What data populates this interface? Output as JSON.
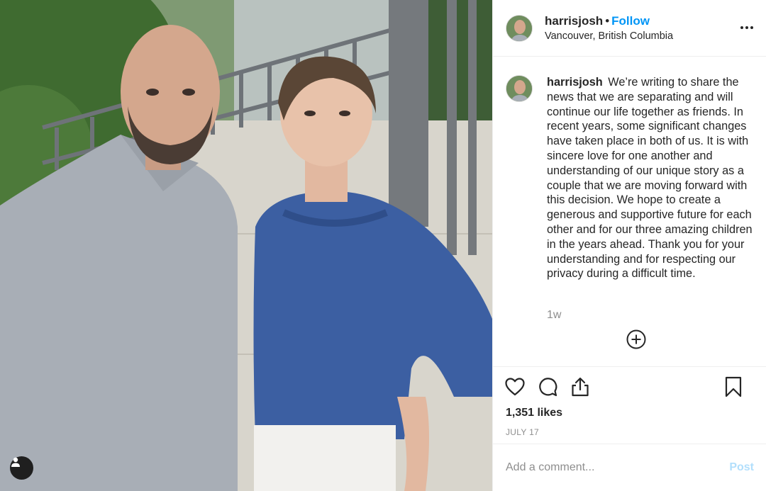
{
  "post": {
    "username": "harrisjosh",
    "separator": "•",
    "follow_label": "Follow",
    "location": "Vancouver, British Columbia",
    "caption": "We’re writing to share the news that we are separating and will continue our life together as friends. In recent years, some significant changes have taken place in both of us. It is with sincere love for one another and understanding of our unique story as a couple that we are moving forward with this decision. We hope to create a generous and supportive future for each other and for our three amazing children in the years ahead. Thank you for your understanding and for respecting our privacy during a difficult time.",
    "time_ago": "1w",
    "likes": "1,351 likes",
    "date": "JULY 17"
  },
  "comment": {
    "placeholder": "Add a comment...",
    "post_label": "Post"
  },
  "icons": {
    "more": "more-options-icon",
    "load_more": "plus-circle-icon",
    "like": "heart-icon",
    "comment": "comment-icon",
    "share": "share-icon",
    "save": "bookmark-icon",
    "tags": "user-tag-icon"
  },
  "colors": {
    "accent": "#0095f6",
    "post_disabled": "#b2dffc",
    "text": "#262626",
    "muted": "#8e8e8e"
  }
}
